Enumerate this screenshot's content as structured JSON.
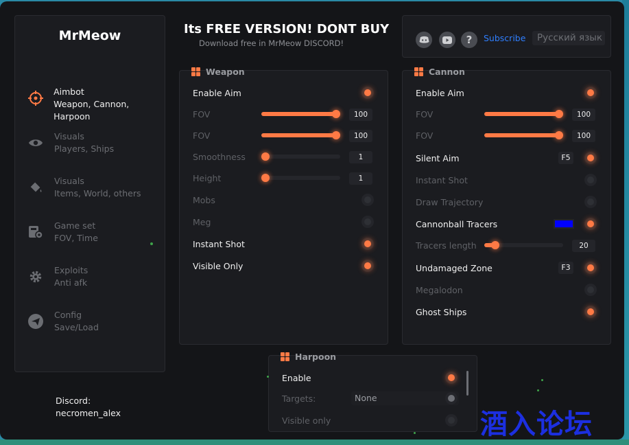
{
  "app": {
    "logo": "MrMeow",
    "header_title": "Its FREE VERSION! DONT BUY",
    "header_subtitle": "Download free in MrMeow DISCORD!"
  },
  "sidebar": {
    "items": [
      {
        "title": "Aimbot",
        "sub": "Weapon, Cannon, Harpoon",
        "icon": "crosshair-icon",
        "active": true
      },
      {
        "title": "Visuals",
        "sub": "Players, Ships",
        "icon": "eye-icon",
        "active": false
      },
      {
        "title": "Visuals",
        "sub": "Items, World, others",
        "icon": "paint-bucket-icon",
        "active": false
      },
      {
        "title": "Game set",
        "sub": "FOV, Time",
        "icon": "game-settings-icon",
        "active": false
      },
      {
        "title": "Exploits",
        "sub": "Anti afk",
        "icon": "gear-icon",
        "active": false
      },
      {
        "title": "Config",
        "sub": "Save/Load",
        "icon": "paper-plane-icon",
        "active": false
      }
    ],
    "discord_label": "Discord:",
    "discord_user": "necromen_alex"
  },
  "topbar": {
    "subscribe": "Subscribe",
    "language": "Русский язык",
    "help_glyph": "?"
  },
  "weapon": {
    "title": "Weapon",
    "enable_aim": "Enable Aim",
    "fov1_label": "FOV",
    "fov1_value": "100",
    "fov1_fill": 1.0,
    "fov2_label": "FOV",
    "fov2_value": "100",
    "fov2_fill": 1.0,
    "smooth_label": "Smoothness",
    "smooth_value": "1",
    "smooth_fill": 0.0,
    "height_label": "Height",
    "height_value": "1",
    "height_fill": 0.0,
    "mobs": "Mobs",
    "meg": "Meg",
    "instant_shot": "Instant Shot",
    "visible_only": "Visible Only"
  },
  "cannon": {
    "title": "Cannon",
    "enable_aim": "Enable Aim",
    "fov1_label": "FOV",
    "fov1_value": "100",
    "fov2_label": "FOV",
    "fov2_value": "100",
    "silent_aim": "Silent Aim",
    "silent_key": "F5",
    "instant_shot": "Instant Shot",
    "draw_trajectory": "Draw Trajectory",
    "cannonball_tracers": "Cannonball Tracers",
    "tracer_color": "#0000ff",
    "tracers_length": "Tracers length",
    "tracers_value": "20",
    "undamaged_zone": "Undamaged Zone",
    "undamaged_key": "F3",
    "megalodon": "Megalodon",
    "ghost_ships": "Ghost Ships"
  },
  "harpoon": {
    "title": "Harpoon",
    "enable": "Enable",
    "targets_label": "Targets:",
    "targets_value": "None",
    "visible_only": "Visible only"
  },
  "watermark": "酒入论坛",
  "colors": {
    "accent": "#ff7a45",
    "link": "#2f7fff",
    "panel": "#1b1c20",
    "window": "#141518"
  }
}
